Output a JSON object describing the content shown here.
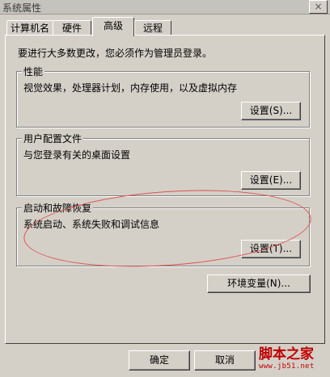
{
  "window": {
    "title": "系统属性",
    "close_glyph": "×"
  },
  "tabs": [
    {
      "label": "计算机名"
    },
    {
      "label": "硬件"
    },
    {
      "label": "高级",
      "active": true
    },
    {
      "label": "远程"
    }
  ],
  "intro_text": "要进行大多数更改，您必须作为管理员登录。",
  "groups": {
    "performance": {
      "title": "性能",
      "description": "视觉效果，处理器计划，内存使用，以及虚拟内存",
      "button": "设置(S)..."
    },
    "user_profiles": {
      "title": "用户配置文件",
      "description": "与您登录有关的桌面设置",
      "button": "设置(E)..."
    },
    "startup_recovery": {
      "title": "启动和故障恢复",
      "description": "系统启动、系统失败和调试信息",
      "button": "设置(T)..."
    }
  },
  "env_button": "环境变量(N)...",
  "footer": {
    "ok": "确定",
    "cancel": "取消"
  },
  "watermark": {
    "brand": "脚本之家",
    "url": "www.jb51.net"
  },
  "colors": {
    "dialog_bg": "#d4d0c8",
    "annotation": "#e05050",
    "watermark": "#c00000"
  }
}
